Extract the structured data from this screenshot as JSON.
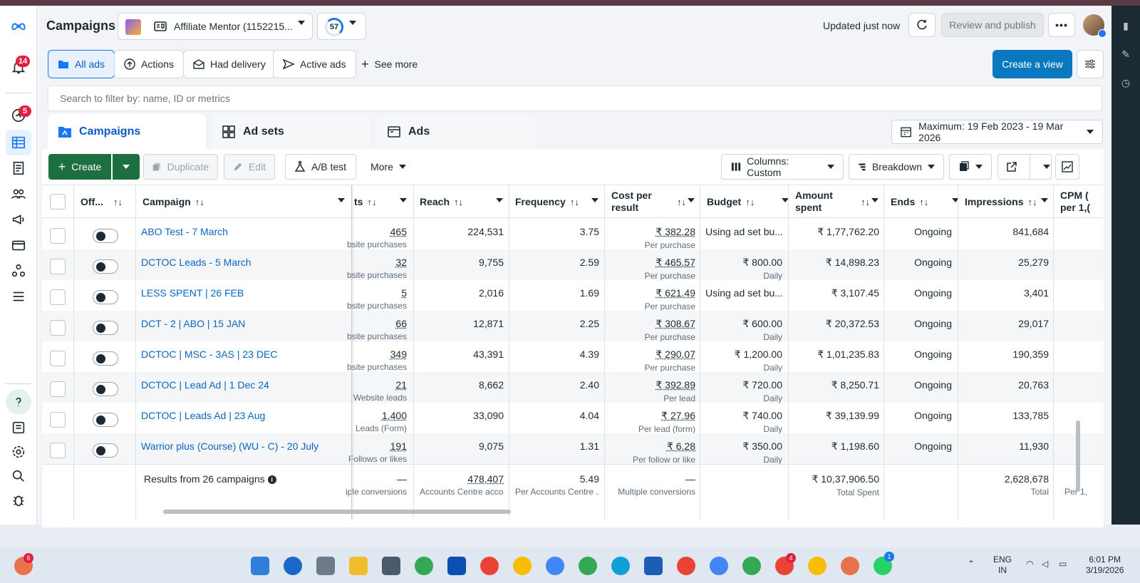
{
  "app": {
    "title": "Campaigns",
    "account_name": "Affiliate Mentor (1152215...",
    "score": "57",
    "updated": "Updated just now",
    "review_publish": "Review and publish",
    "nav_badges": {
      "notifications": "14",
      "activity": "5"
    }
  },
  "filters": {
    "all_ads": "All ads",
    "actions": "Actions",
    "had_delivery": "Had delivery",
    "active_ads": "Active ads",
    "see_more": "See more",
    "create_view": "Create a view"
  },
  "search": {
    "placeholder": "Search to filter by: name, ID or metrics"
  },
  "tabs": {
    "campaigns": "Campaigns",
    "ad_sets": "Ad sets",
    "ads": "Ads"
  },
  "date_range": "Maximum: 19 Feb 2023 - 19 Mar 2026",
  "toolbar": {
    "create": "Create",
    "duplicate": "Duplicate",
    "edit": "Edit",
    "ab_test": "A/B test",
    "more": "More",
    "columns": "Columns: Custom",
    "breakdown": "Breakdown"
  },
  "table": {
    "headers": {
      "offon": "Off...",
      "campaign": "Campaign",
      "results": "ts",
      "reach": "Reach",
      "frequency": "Frequency",
      "cpr_1": "Cost per",
      "cpr_2": "result",
      "budget": "Budget",
      "amount_1": "Amount",
      "amount_2": "spent",
      "ends": "Ends",
      "impressions": "Impressions",
      "cpm_1": "CPM (",
      "cpm_2": "per 1,("
    },
    "rows": [
      {
        "campaign": "ABO Test - 7 March",
        "results": "465",
        "results_sub": "bsite purchases",
        "reach": "224,531",
        "frequency": "3.75",
        "cpr": "₹ 382.28",
        "cpr_sub": "Per purchase",
        "budget": "Using ad set bu...",
        "budget_sub": "",
        "amount": "₹ 1,77,762.20",
        "ends": "Ongoing",
        "impressions": "841,684"
      },
      {
        "campaign": "DCTOC Leads - 5 March",
        "results": "32",
        "results_sub": "bsite purchases",
        "reach": "9,755",
        "frequency": "2.59",
        "cpr": "₹ 465.57",
        "cpr_sub": "Per purchase",
        "budget": "₹ 800.00",
        "budget_sub": "Daily",
        "amount": "₹ 14,898.23",
        "ends": "Ongoing",
        "impressions": "25,279"
      },
      {
        "campaign": "LESS SPENT | 26 FEB",
        "results": "5",
        "results_sub": "bsite purchases",
        "reach": "2,016",
        "frequency": "1.69",
        "cpr": "₹ 621.49",
        "cpr_sub": "Per purchase",
        "budget": "Using ad set bu...",
        "budget_sub": "",
        "amount": "₹ 3,107.45",
        "ends": "Ongoing",
        "impressions": "3,401"
      },
      {
        "campaign": "DCT - 2 | ABO | 15 JAN",
        "results": "66",
        "results_sub": "bsite purchases",
        "reach": "12,871",
        "frequency": "2.25",
        "cpr": "₹ 308.67",
        "cpr_sub": "Per purchase",
        "budget": "₹ 600.00",
        "budget_sub": "Daily",
        "amount": "₹ 20,372.53",
        "ends": "Ongoing",
        "impressions": "29,017"
      },
      {
        "campaign": "DCTOC | MSC - 3AS | 23 DEC",
        "results": "349",
        "results_sub": "bsite purchases",
        "reach": "43,391",
        "frequency": "4.39",
        "cpr": "₹ 290.07",
        "cpr_sub": "Per purchase",
        "budget": "₹ 1,200.00",
        "budget_sub": "Daily",
        "amount": "₹ 1,01,235.83",
        "ends": "Ongoing",
        "impressions": "190,359"
      },
      {
        "campaign": "DCTOC | Lead Ad | 1 Dec 24",
        "results": "21",
        "results_sub": "Website leads",
        "reach": "8,662",
        "frequency": "2.40",
        "cpr": "₹ 392.89",
        "cpr_sub": "Per lead",
        "budget": "₹ 720.00",
        "budget_sub": "Daily",
        "amount": "₹ 8,250.71",
        "ends": "Ongoing",
        "impressions": "20,763"
      },
      {
        "campaign": "DCTOC | Leads Ad | 23 Aug",
        "results": "1,400",
        "results_sub": "Leads (Form)",
        "reach": "33,090",
        "frequency": "4.04",
        "cpr": "₹ 27.96",
        "cpr_sub": "Per lead (form)",
        "budget": "₹ 740.00",
        "budget_sub": "Daily",
        "amount": "₹ 39,139.99",
        "ends": "Ongoing",
        "impressions": "133,785"
      },
      {
        "campaign": "Warrior plus (Course) (WU - C) - 20 July",
        "results": "191",
        "results_sub": "Follows or likes",
        "reach": "9,075",
        "frequency": "1.31",
        "cpr": "₹ 6.28",
        "cpr_sub": "Per follow or like",
        "budget": "₹ 350.00",
        "budget_sub": "Daily",
        "amount": "₹ 1,198.60",
        "ends": "Ongoing",
        "impressions": "11,930"
      }
    ],
    "summary": {
      "label": "Results from 26 campaigns",
      "results": "—",
      "results_sub": "iple conversions",
      "reach": "478,407",
      "reach_sub": "Accounts Centre acco...",
      "frequency": "5.49",
      "frequency_sub": "Per Accounts Centre ...",
      "cpr": "—",
      "cpr_sub": "Multiple conversions",
      "amount": "₹ 10,37,906.50",
      "amount_sub": "Total Spent",
      "impressions": "2,628,678",
      "impressions_sub": "Total",
      "cpm_sub": "Per 1,"
    }
  },
  "taskbar": {
    "lang_1": "ENG",
    "lang_2": "IN",
    "time": "6:01 PM",
    "date": "3/19/2026",
    "badges": {
      "copilot": "6",
      "chrome_profile": "4",
      "whatsapp": "1"
    }
  },
  "colors": {
    "primary": "#0a78be",
    "create_green": "#1d6f42",
    "link_blue": "#0a66c2",
    "badge_red": "#e41e3f"
  }
}
